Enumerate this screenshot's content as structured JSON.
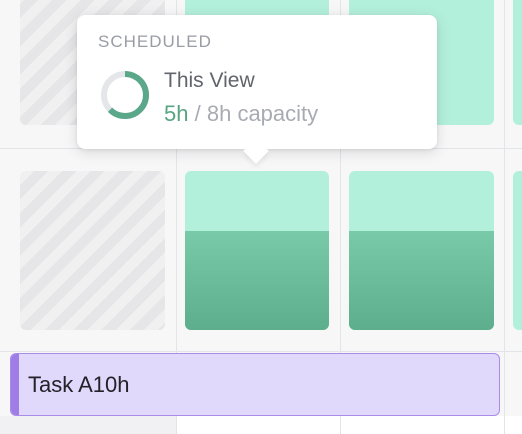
{
  "tooltip": {
    "header": "SCHEDULED",
    "view_label": "This View",
    "scheduled_hours": "5h",
    "separator": "/",
    "capacity_text": "8h capacity",
    "scheduled_fraction": 0.625,
    "ring_color": "#5aa78a",
    "ring_track_color": "#e5e6e9"
  },
  "capacity": {
    "fill_color": "#b3f0dc",
    "scheduled_color": "#63b291",
    "days": [
      {
        "scheduled_fraction": 0.625
      },
      {
        "scheduled_fraction": 0.625
      }
    ]
  },
  "task": {
    "label": "Task A10h",
    "color": "#e1d9fb",
    "border_color": "#a98be8"
  }
}
